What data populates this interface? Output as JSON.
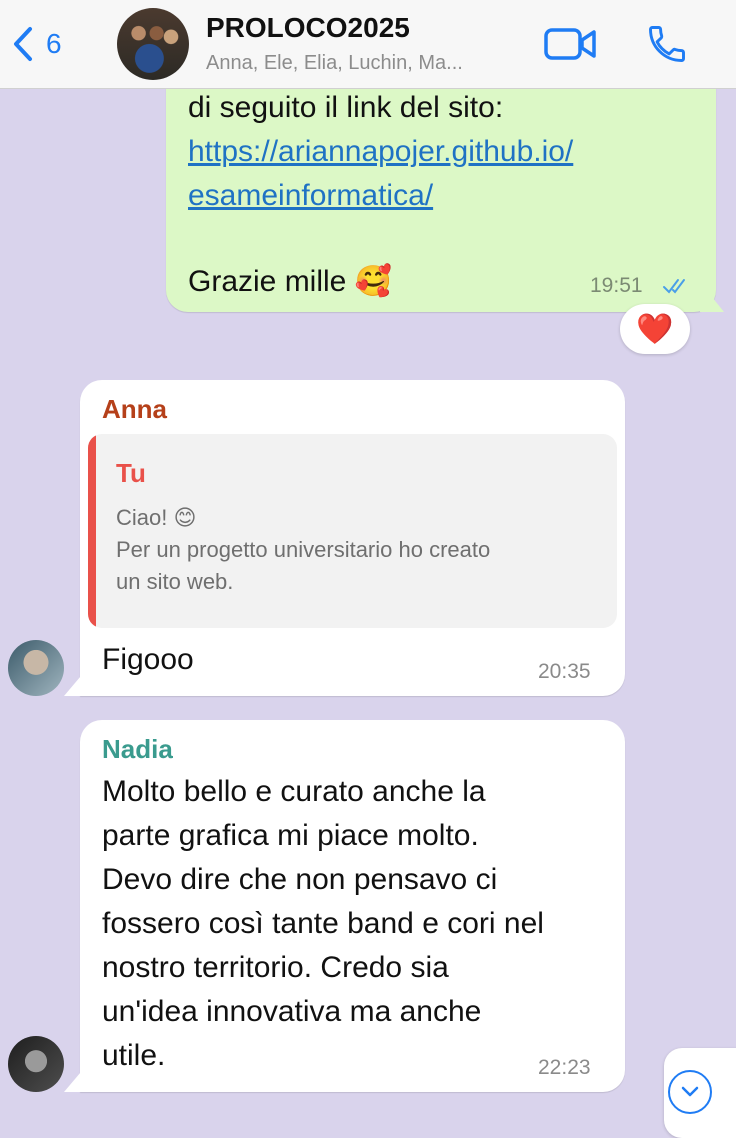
{
  "header": {
    "back_count": "6",
    "group_name": "PROLOCO2025",
    "members": "Anna, Ele, Elia, Luchin, Ma..."
  },
  "messages": {
    "outgoing": {
      "lines": [
        "di seguito il link del sito:",
        "",
        "",
        "",
        "Grazie mille 🥰"
      ],
      "link_line1": "https://ariannapojer.github.io/",
      "link_line2": "esameinformatica/",
      "time": "19:51",
      "status": "read",
      "reaction": "❤️"
    },
    "anna": {
      "sender": "Anna",
      "sender_color": "#b5401a",
      "quote_author": "Tu",
      "quote_line1": "Ciao! 😊",
      "quote_line2": "Per un progetto universitario ho creato",
      "quote_line3": "un sito web.",
      "text": "Figooo",
      "time": "20:35"
    },
    "nadia": {
      "sender": "Nadia",
      "sender_color": "#3a9b8e",
      "lines": [
        "Molto bello e curato anche la",
        "parte grafica mi piace molto.",
        "Devo dire che non pensavo ci",
        "fossero così tante band e cori nel",
        "nostro territorio. Credo sia",
        "un'idea innovativa ma anche",
        "utile."
      ],
      "time": "22:23"
    }
  },
  "colors": {
    "accent": "#1f7cf4",
    "chat_background": "#d9d3ec",
    "outgoing_bubble": "#dcf8c6",
    "quote_bar": "#e9514a"
  },
  "icons": [
    "chevron-left-icon",
    "video-call-icon",
    "phone-icon",
    "double-check-icon",
    "chevron-down-icon"
  ]
}
